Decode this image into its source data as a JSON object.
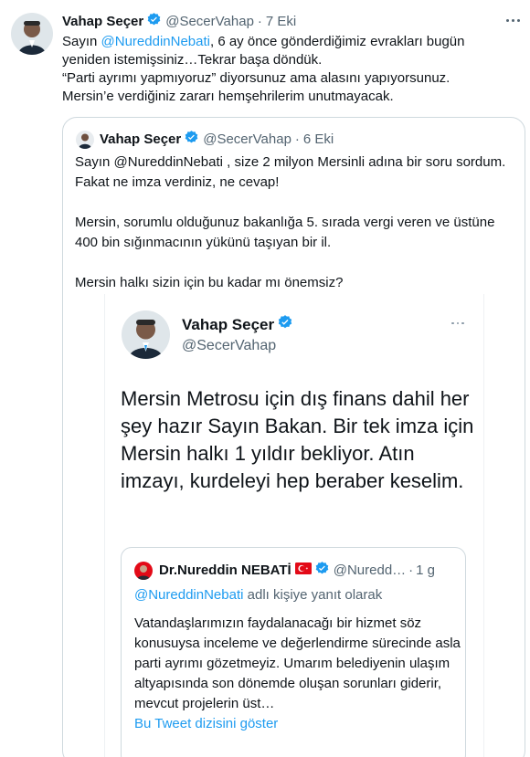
{
  "main_tweet": {
    "name": "Vahap Seçer",
    "handle": "@SecerVahap",
    "separator": "·",
    "time": "7 Eki",
    "text_prefix": "Sayın ",
    "mention": "@NureddinNebati",
    "text_rest": ", 6 ay önce gönderdiğimiz evrakları bugün yeniden istemişsiniz…Tekrar başa döndük.\n“Parti ayrımı yapmıyoruz” diyorsunuz ama alasını yapıyorsunuz.\nMersin’e verdiğiniz zararı hemşehrilerim unutmayacak.",
    "more_icon": "more-horizontal-icon"
  },
  "quoted_tweet": {
    "name": "Vahap Seçer",
    "handle": "@SecerVahap",
    "separator": "·",
    "time": "6 Eki",
    "text": "Sayın @NureddinNebati , size 2 milyon Mersinli adına bir soru sordum. Fakat ne imza verdiniz, ne cevap!\n\nMersin, sorumlu olduğunuz bakanlığa 5. sırada vergi veren ve üstüne 400 bin sığınmacının yükünü taşıyan bir il.\n\nMersin halkı sizin için bu kadar mı önemsiz?"
  },
  "screenshot_tweet": {
    "name": "Vahap Seçer",
    "handle": "@SecerVahap",
    "text": "Mersin Metrosu için dış finans dahil her şey hazır Sayın Bakan. Bir tek imza için Mersin halkı 1 yıldır bekliyor. Atın imzayı, kurdeleyi hep beraber keselim.",
    "inner_quote": {
      "name": "Dr.Nureddin NEBATİ",
      "handle": "@Nuredd…",
      "separator": "·",
      "time": "1 g",
      "reply_mention": "@NureddinNebati",
      "reply_suffix": " adlı kişiye yanıt olarak",
      "text": "Vatandaşlarımızın faydalanacağı bir hizmet söz konusuysa inceleme ve değerlendirme sürecinde asla parti ayrımı gözetmeyiz. Umarım belediyenin ulaşım altyapısında son dönemde oluşan sorunları giderir, mevcut projelerin üst…",
      "show_thread": "Bu Tweet dizisini göster"
    }
  },
  "colors": {
    "accent": "#1d9bf0",
    "text": "#0f1419",
    "secondary": "#536471",
    "border": "#cfd9de"
  }
}
